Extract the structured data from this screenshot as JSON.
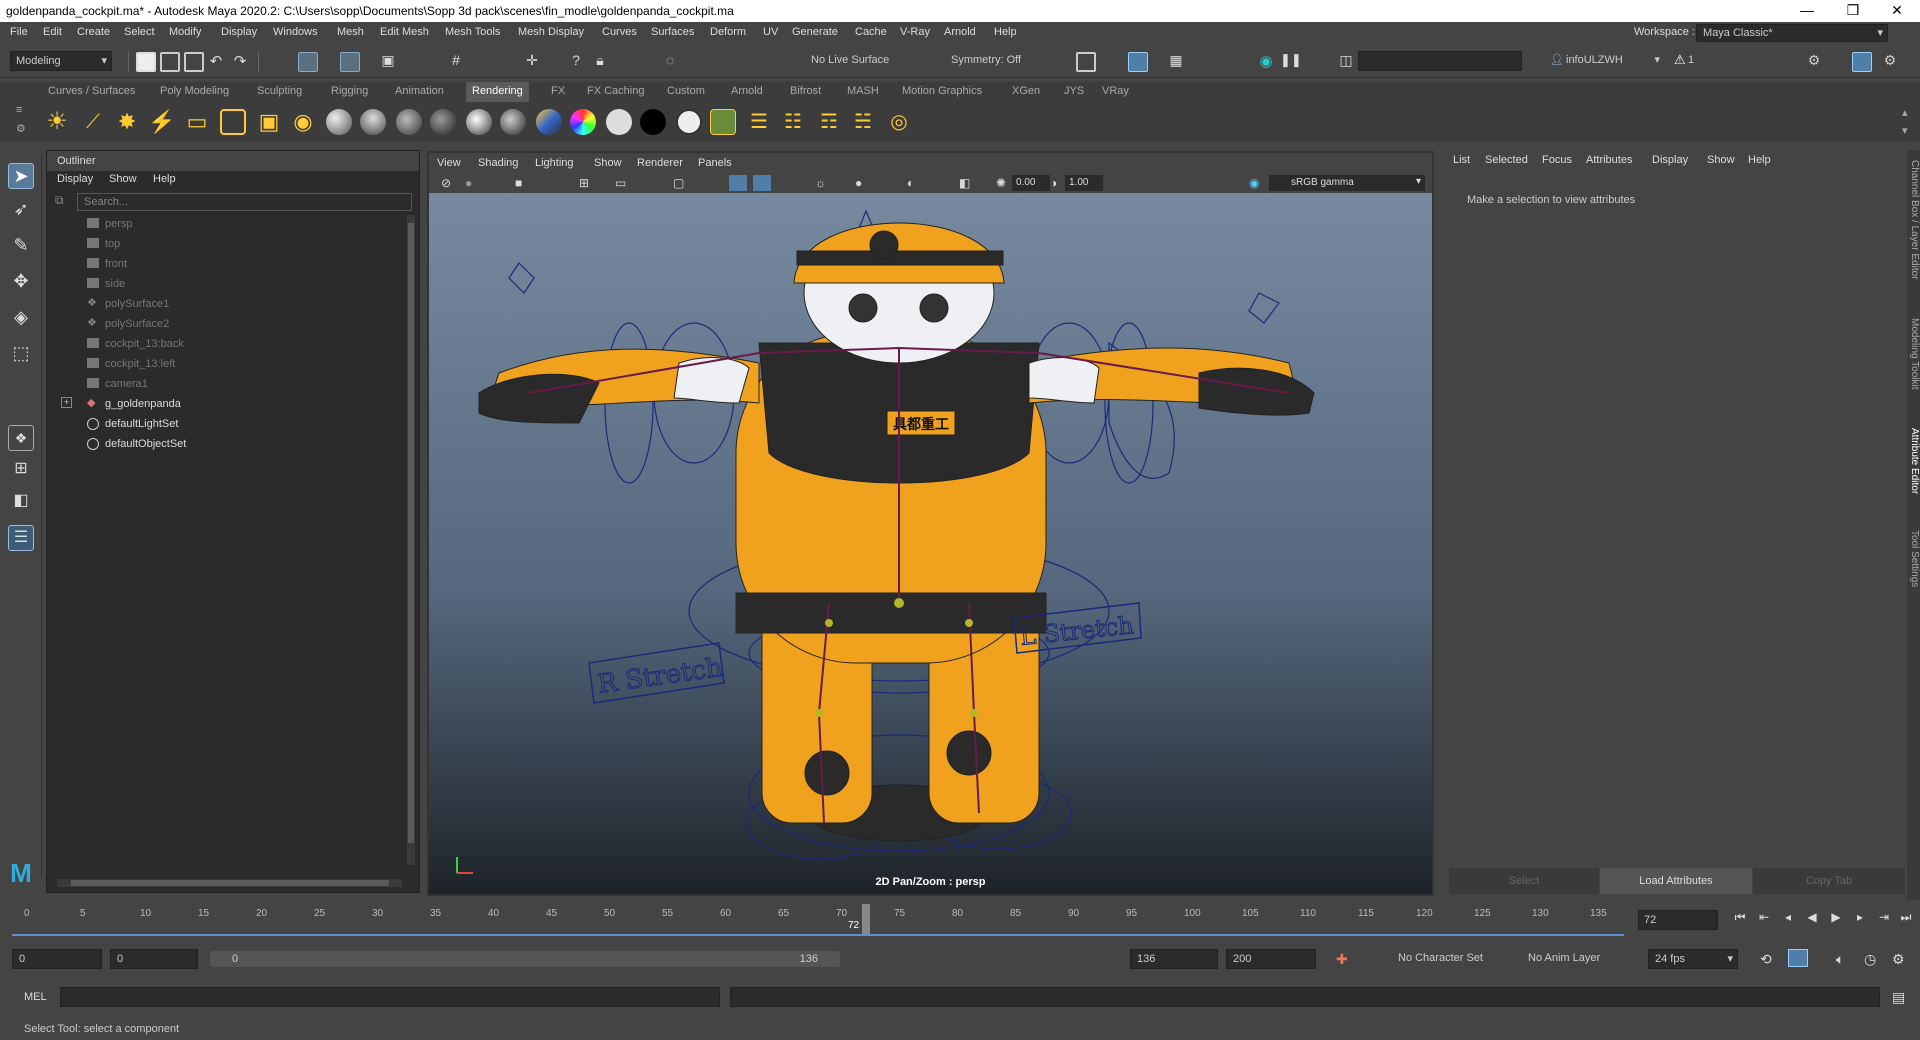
{
  "window": {
    "title": "goldenpanda_cockpit.ma* - Autodesk Maya 2020.2: C:\\Users\\sopp\\Documents\\Sopp 3d pack\\scenes\\fin_modle\\goldenpanda_cockpit.ma",
    "minimize": "—",
    "restore": "❐",
    "close": "✕"
  },
  "menubar": [
    "File",
    "Edit",
    "Create",
    "Select",
    "Modify",
    "Display",
    "Windows",
    "Mesh",
    "Edit Mesh",
    "Mesh Tools",
    "Mesh Display",
    "Curves",
    "Surfaces",
    "Deform",
    "UV",
    "Generate",
    "Cache",
    "V-Ray",
    "Arnold",
    "Help"
  ],
  "workspace": {
    "label": "Workspace :",
    "value": "Maya Classic*"
  },
  "statusline": {
    "mode": "Modeling",
    "live_surface": "No Live Surface",
    "symmetry": "Symmetry: Off",
    "user": "infoULZWH",
    "warning_count": "1"
  },
  "shelf": {
    "tabs": [
      "Curves / Surfaces",
      "Poly Modeling",
      "Sculpting",
      "Rigging",
      "Animation",
      "Rendering",
      "FX",
      "FX Caching",
      "Custom",
      "Arnold",
      "Bifrost",
      "MASH",
      "Motion Graphics",
      "XGen",
      "JYS",
      "VRay"
    ],
    "active_tab": "Rendering"
  },
  "outliner": {
    "title": "Outliner",
    "menus": [
      "Display",
      "Show",
      "Help"
    ],
    "search_placeholder": "Search...",
    "items": [
      {
        "label": "persp",
        "icon": "camera-icon"
      },
      {
        "label": "top",
        "icon": "camera-icon"
      },
      {
        "label": "front",
        "icon": "camera-icon"
      },
      {
        "label": "side",
        "icon": "camera-icon"
      },
      {
        "label": "polySurface1",
        "icon": "mesh-icon"
      },
      {
        "label": "polySurface2",
        "icon": "mesh-icon"
      },
      {
        "label": "cockpit_13:back",
        "icon": "camera-icon"
      },
      {
        "label": "cockpit_13:left",
        "icon": "camera-icon"
      },
      {
        "label": "camera1",
        "icon": "camera-icon"
      },
      {
        "label": "g_goldenpanda",
        "icon": "group-icon"
      },
      {
        "label": "defaultLightSet",
        "icon": "set-icon"
      },
      {
        "label": "defaultObjectSet",
        "icon": "set-icon"
      }
    ]
  },
  "viewport": {
    "menus": [
      "View",
      "Shading",
      "Lighting",
      "Show",
      "Renderer",
      "Panels"
    ],
    "exposure": "0.00",
    "gamma": "1.00",
    "color_space": "sRGB gamma",
    "hud_label": "2D Pan/Zoom : persp",
    "scene_text": {
      "right_stretch": "R Stretch",
      "left_stretch": "L Stretch",
      "badge": "具都重工"
    }
  },
  "attribute_editor": {
    "menus": [
      "List",
      "Selected",
      "Focus",
      "Attributes",
      "Display",
      "Show",
      "Help"
    ],
    "message": "Make a selection to view attributes",
    "buttons": {
      "select": "Select",
      "load": "Load Attributes",
      "copy": "Copy Tab"
    }
  },
  "side_tabs": [
    "Channel Box / Layer Editor",
    "Modeling Toolkit",
    "Attribute Editor",
    "Tool Settings"
  ],
  "timeline": {
    "ticks": [
      "0",
      "5",
      "10",
      "15",
      "20",
      "25",
      "30",
      "35",
      "40",
      "45",
      "50",
      "55",
      "60",
      "65",
      "70",
      "75",
      "80",
      "85",
      "90",
      "95",
      "100",
      "105",
      "110",
      "115",
      "120",
      "125",
      "130",
      "135"
    ],
    "current_frame": "72",
    "current_field": "72"
  },
  "range": {
    "start": "0",
    "anim_start": "0",
    "slider_start": "0",
    "slider_end": "136",
    "end": "136",
    "anim_end": "200",
    "character_set": "No Character Set",
    "anim_layer": "No Anim Layer",
    "fps": "24 fps"
  },
  "mel": {
    "label": "MEL"
  },
  "helpline": "Select Tool: select a component"
}
